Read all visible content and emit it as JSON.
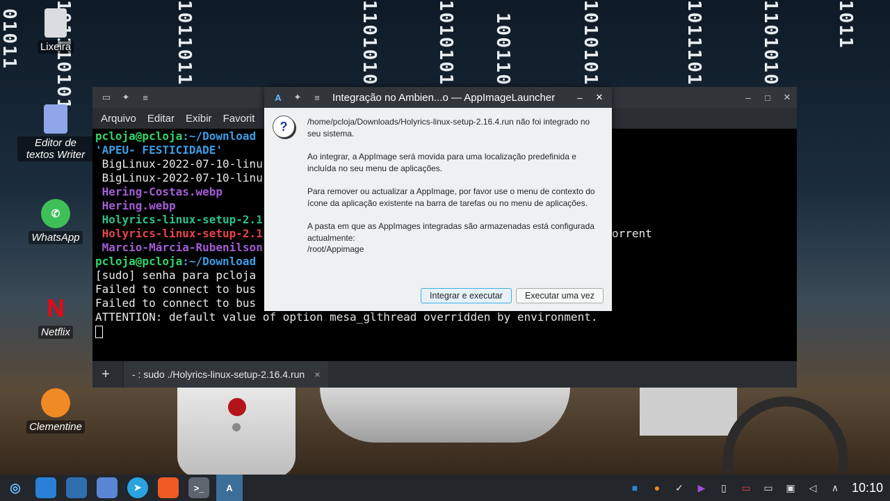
{
  "wallpaper": {
    "binary": [
      "01011",
      "101110101",
      "101101101",
      "1101010",
      "10101011",
      "1001100",
      "10101011",
      "101110110",
      "110101011",
      "1011"
    ]
  },
  "desktop": {
    "icons": [
      {
        "label": "Lixeira",
        "icon": "trash-icon"
      },
      {
        "label": "Editor de textos Writer",
        "icon": "writer-icon"
      },
      {
        "label": "WhatsApp",
        "icon": "whatsapp-icon"
      },
      {
        "label": "Netflix",
        "icon": "netflix-icon"
      },
      {
        "label": "Clementine",
        "icon": "clementine-icon"
      }
    ]
  },
  "terminal": {
    "titlebar_icons": [
      "terminal-icon",
      "pin-icon",
      "menu-icon"
    ],
    "window_controls": [
      "minimize-icon",
      "maximize-icon",
      "close-icon"
    ],
    "menu": [
      "Arquivo",
      "Editar",
      "Exibir",
      "Favorit"
    ],
    "lines": [
      {
        "prompt": "pcloja@pcloja",
        "path": ":~/Download",
        "text": ""
      },
      {
        "text": "'APEU- FESTICIDADE'",
        "color": "blue"
      },
      {
        "text": " BigLinux-2022-07-10-linu",
        "color": "white"
      },
      {
        "text": " BigLinux-2022-07-10-linu",
        "color": "white"
      },
      {
        "text": " Hering-Costas.webp",
        "color": "purple"
      },
      {
        "text": " Hering.webp",
        "color": "purple"
      },
      {
        "text": " Holyrics-linux-setup-2.1",
        "color": "teal"
      },
      {
        "text": " Holyrics-linux-setup-2.1",
        "color": "red"
      },
      {
        "text": " Marcio-Márcia-Rubenilson",
        "color": "purple"
      },
      {
        "prompt": "pcloja@pcloja",
        "path": ":~/Download",
        "text": ""
      },
      {
        "text": "[sudo] senha para pcloja",
        "color": "white"
      },
      {
        "text": "Failed to connect to bus",
        "color": "white"
      },
      {
        "text": "Failed to connect to bus",
        "color": "white"
      },
      {
        "text": "ATTENTION: default value of option mesa_glthread overridden by environment.",
        "color": "white"
      }
    ],
    "fragment_right": "orrent",
    "tab_add": "+",
    "tab_label": "- : sudo ./Holyrics-linux-setup-2.16.4.run",
    "tab_close": "×"
  },
  "dialog": {
    "title": "Integração no Ambien...o — AppImageLauncher",
    "title_icons": [
      "appimagelauncher-icon",
      "pin-icon",
      "menu-icon"
    ],
    "controls": [
      "minimize-icon",
      "close-icon"
    ],
    "paragraphs": [
      "/home/pcloja/Downloads/Holyrics-linux-setup-2.16.4.run não foi integrado no seu sistema.",
      "Ao integrar, a AppImage será movida para uma localização predefinida e incluída no seu menu de aplicações.",
      "Para remover ou actualizar a AppImage, por favor use o menu de contexto do ícone da aplicação existente na barra de tarefas ou no menu de aplicações.",
      "A pasta em que as AppImages integradas são armazenadas está configurada actualmente:\n/root/Appimage"
    ],
    "btn_integrate": "Integrar e executar",
    "btn_once": "Executar uma vez"
  },
  "taskbar": {
    "launchers": [
      "biglinux-menu-icon",
      "file-manager-icon",
      "control-center-icon",
      "big-store-icon",
      "telegram-icon",
      "brave-icon",
      "terminal-icon",
      "appimagelauncher-icon"
    ],
    "tray": [
      "dropbox-icon",
      "clementine-tray-icon",
      "check-icon",
      "media-icon",
      "clipboard-icon",
      "battery-icon",
      "display-icon",
      "network-icon",
      "volume-icon",
      "expand-icon"
    ],
    "clock": "10:10"
  }
}
